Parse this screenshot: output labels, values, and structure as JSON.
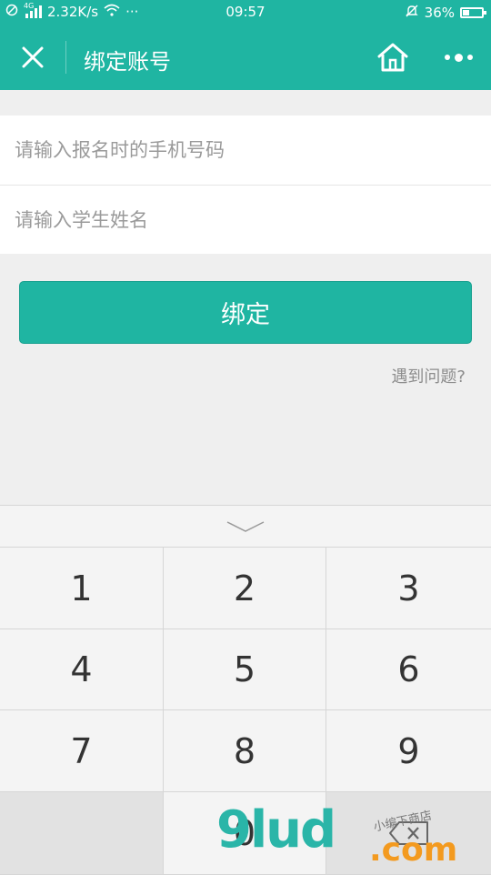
{
  "status_bar": {
    "network": "4G",
    "speed": "2.32K/s",
    "more": "···",
    "time": "09:57",
    "battery": "36%",
    "battery_level": 0.36
  },
  "nav": {
    "title": "绑定账号"
  },
  "form": {
    "phone_placeholder": "请输入报名时的手机号码",
    "name_placeholder": "请输入学生姓名",
    "submit_label": "绑定",
    "help_link": "遇到问题?"
  },
  "keyboard": {
    "keys": [
      "1",
      "2",
      "3",
      "4",
      "5",
      "6",
      "7",
      "8",
      "9",
      "",
      "0",
      ""
    ]
  },
  "watermark": {
    "brand": "9lud",
    "suffix": ".com",
    "tagline": "小编下商店"
  },
  "colors": {
    "accent": "#1fb5a2",
    "background": "#efefef"
  }
}
